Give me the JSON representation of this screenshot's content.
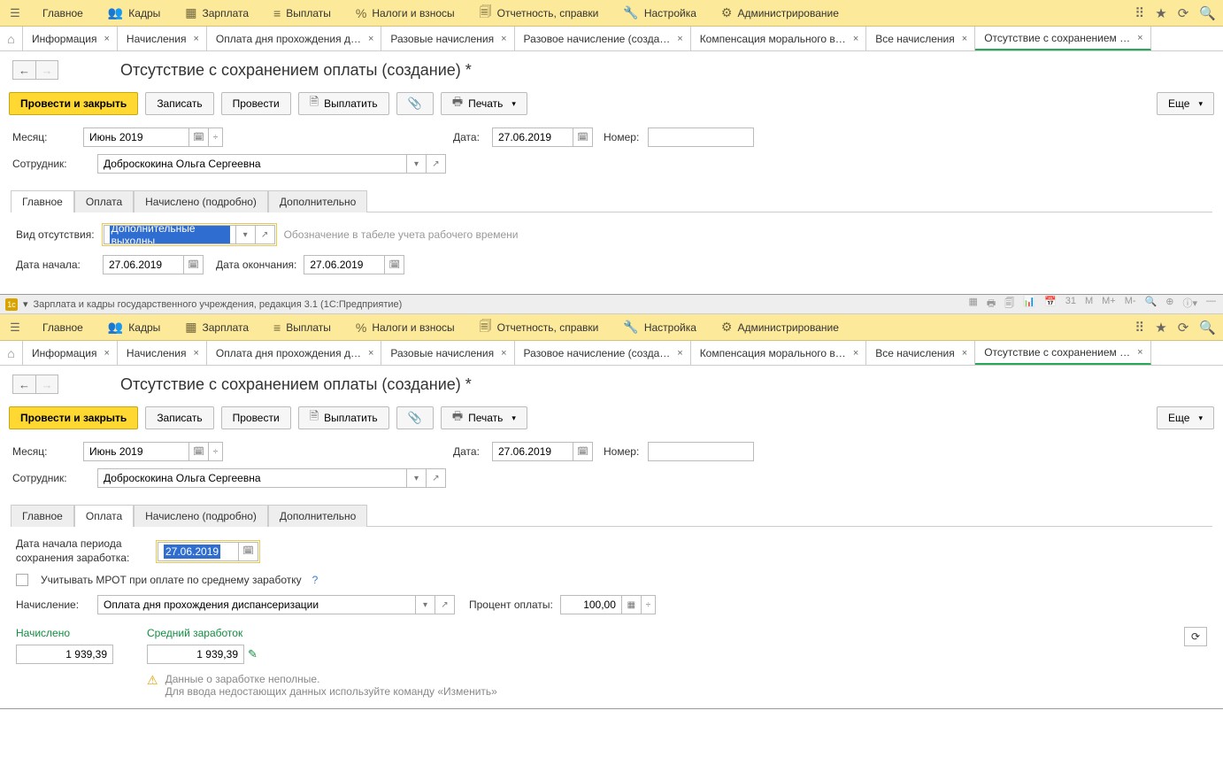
{
  "menu": {
    "main": "Главное",
    "kadry": "Кадры",
    "zarplata": "Зарплата",
    "vyplaty": "Выплаты",
    "nalogi": "Налоги и взносы",
    "otchet": "Отчетность, справки",
    "nastroyka": "Настройка",
    "admin": "Администрирование"
  },
  "tabs": [
    "Информация",
    "Начисления",
    "Оплата дня прохождения д…",
    "Разовые начисления",
    "Разовое начисление (созда…",
    "Компенсация морального в…",
    "Все начисления",
    "Отсутствие с сохранением …"
  ],
  "page_title": "Отсутствие с сохранением оплаты (создание) *",
  "toolbar": {
    "provesti_close": "Провести и закрыть",
    "zapisat": "Записать",
    "provesti": "Провести",
    "vyplatit": "Выплатить",
    "pechat": "Печать",
    "more": "Еще"
  },
  "form": {
    "month_lbl": "Месяц:",
    "month_val": "Июнь 2019",
    "date_lbl": "Дата:",
    "date_val": "27.06.2019",
    "number_lbl": "Номер:",
    "number_val": "",
    "employee_lbl": "Сотрудник:",
    "employee_val": "Доброскокина Ольга Сергеевна"
  },
  "inner_tabs_a": [
    "Главное",
    "Оплата",
    "Начислено (подробно)",
    "Дополнительно"
  ],
  "main_tab_a": {
    "kind_lbl": "Вид отсутствия:",
    "kind_val": "Дополнительные выходны",
    "kind_hint": "Обозначение в табеле учета рабочего времени",
    "start_lbl": "Дата начала:",
    "start_val": "27.06.2019",
    "end_lbl": "Дата окончания:",
    "end_val": "27.06.2019"
  },
  "app2_title": "Зарплата и кадры государственного учреждения, редакция 3.1  (1С:Предприятие)",
  "inner_tabs_b": [
    "Главное",
    "Оплата",
    "Начислено (подробно)",
    "Дополнительно"
  ],
  "main_tab_b": {
    "period_lbl": "Дата начала периода сохранения заработка:",
    "period_val": "27.06.2019",
    "mrot_lbl": "Учитывать МРОТ при оплате по среднему заработку",
    "accrual_lbl": "Начисление:",
    "accrual_val": "Оплата дня прохождения диспансеризации",
    "percent_lbl": "Процент оплаты:",
    "percent_val": "100,00",
    "accrued_head": "Начислено",
    "avg_head": "Средний заработок",
    "accrued_val": "1 939,39",
    "avg_val": "1 939,39",
    "warn1": "Данные о заработке неполные.",
    "warn2": "Для ввода недостающих данных используйте команду «Изменить»"
  }
}
